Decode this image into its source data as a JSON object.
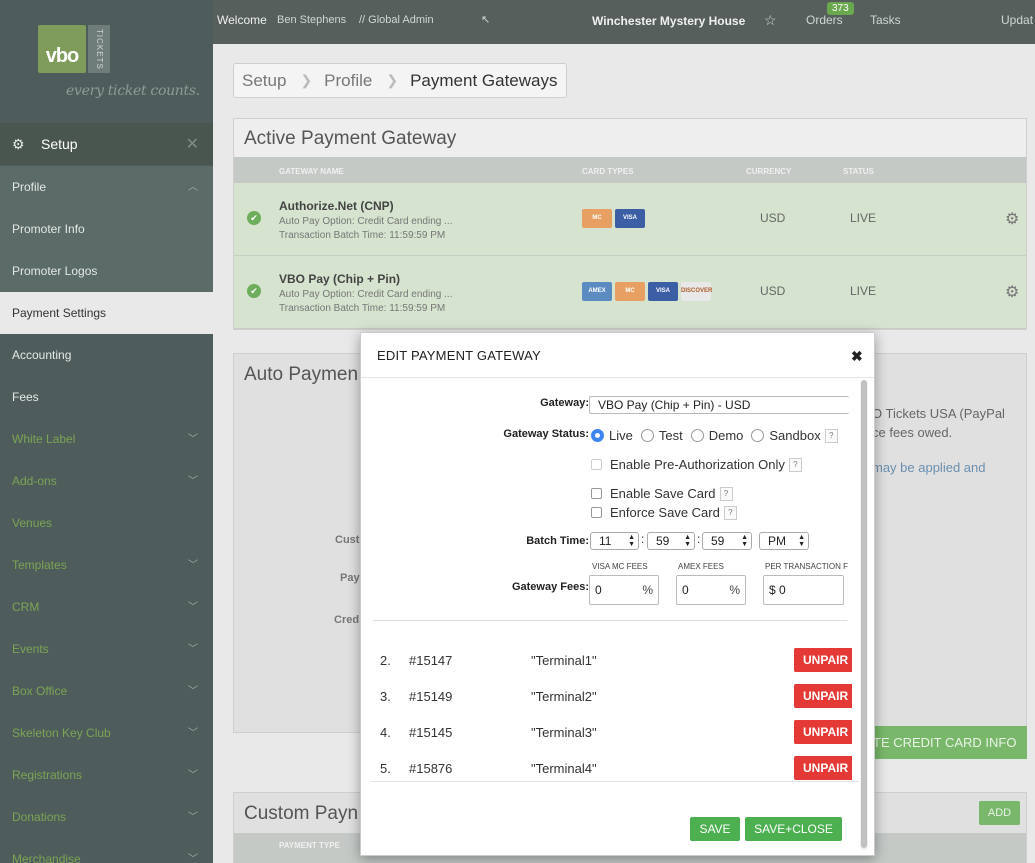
{
  "app": {
    "logo_text": "vbo",
    "logo_side": "TICKETS",
    "tagline": "every ticket counts."
  },
  "sidebar": {
    "header": "Setup",
    "items": [
      {
        "label": "Profile",
        "style": "section",
        "chevron": "up"
      },
      {
        "label": "Promoter Info",
        "style": "section"
      },
      {
        "label": "Promoter Logos",
        "style": "section"
      },
      {
        "label": "Payment Settings",
        "style": "active"
      },
      {
        "label": "Accounting",
        "style": "plain"
      },
      {
        "label": "Fees",
        "style": "plain"
      },
      {
        "label": "White Label",
        "style": "green",
        "chevron": "down"
      },
      {
        "label": "Add-ons",
        "style": "green",
        "chevron": "down"
      },
      {
        "label": "Venues",
        "style": "green"
      },
      {
        "label": "Templates",
        "style": "green",
        "chevron": "down"
      },
      {
        "label": "CRM",
        "style": "green",
        "chevron": "down"
      },
      {
        "label": "Events",
        "style": "green",
        "chevron": "down"
      },
      {
        "label": "Box Office",
        "style": "green",
        "chevron": "down"
      },
      {
        "label": "Skeleton Key Club",
        "style": "green",
        "chevron": "down"
      },
      {
        "label": "Registrations",
        "style": "green",
        "chevron": "down"
      },
      {
        "label": "Donations",
        "style": "green",
        "chevron": "down"
      },
      {
        "label": "Merchandise",
        "style": "green",
        "chevron": "down"
      }
    ]
  },
  "topbar": {
    "welcome": "Welcome",
    "user": "Ben Stephens",
    "role": "// Global Admin",
    "venue": "Winchester Mystery House",
    "orders": "Orders",
    "orders_count": "373",
    "tasks": "Tasks",
    "updates": "Updat"
  },
  "breadcrumb": [
    "Setup",
    "Profile",
    "Payment Gateways"
  ],
  "active_gateway": {
    "title": "Active Payment Gateway",
    "columns": [
      "GATEWAY NAME",
      "CARD TYPES",
      "CURRENCY",
      "STATUS"
    ],
    "rows": [
      {
        "name": "Authorize.Net (CNP)",
        "autopay": "Auto Pay Option: Credit Card ending ...",
        "batch": "Transaction Batch Time: 11:59:59 PM",
        "cards": [
          "mc",
          "visa"
        ],
        "currency": "USD",
        "status": "LIVE"
      },
      {
        "name": "VBO Pay (Chip + Pin)",
        "autopay": "Auto Pay Option: Credit Card ending ...",
        "batch": "Transaction Batch Time: 11:59:59 PM",
        "cards": [
          "amex",
          "mc",
          "visa",
          "disc"
        ],
        "currency": "USD",
        "status": "LIVE"
      }
    ]
  },
  "card_labels": {
    "mc": "MC",
    "visa": "VISA",
    "amex": "AMEX",
    "disc": "DISCOVER"
  },
  "auto_payment": {
    "title": "Auto Paymen",
    "text1": "O Tickets USA (PayPal",
    "text2": "ce fees owed.",
    "text3": "may be applied and",
    "labels": [
      "Cust",
      "Pay",
      "Cred"
    ],
    "update_button": "TE CREDIT CARD INFO"
  },
  "custom_payment": {
    "title": "Custom Payn",
    "add_button": "ADD",
    "column": "PAYMENT TYPE"
  },
  "modal": {
    "title": "EDIT PAYMENT GATEWAY",
    "gateway_label": "Gateway:",
    "gateway_value": "VBO Pay (Chip + Pin) - USD",
    "status_label": "Gateway Status:",
    "status_options": [
      "Live",
      "Test",
      "Demo",
      "Sandbox"
    ],
    "status_selected": "Live",
    "help": "?",
    "preauth_label": "Enable Pre-Authorization Only",
    "save_card_label": "Enable Save Card",
    "enforce_save_label": "Enforce Save Card",
    "batch_label": "Batch Time:",
    "batch_hour": "11",
    "batch_minute": "59",
    "batch_second": "59",
    "batch_ampm": "PM",
    "fees_label": "Gateway Fees:",
    "fee_headers": [
      "VISA MC FEES",
      "AMEX FEES",
      "PER TRANSACTION F"
    ],
    "visa_mc_fee": "0",
    "amex_fee": "0",
    "per_txn_fee": "0",
    "percent": "%",
    "dollar": "$",
    "terminals": [
      {
        "num": "2.",
        "id": "#15147",
        "name": "\"Terminal1\""
      },
      {
        "num": "3.",
        "id": "#15149",
        "name": "\"Terminal2\""
      },
      {
        "num": "4.",
        "id": "#15145",
        "name": "\"Terminal3\""
      },
      {
        "num": "5.",
        "id": "#15876",
        "name": "\"Terminal4\""
      }
    ],
    "unpair_label": "UNPAIR",
    "save_label": "SAVE",
    "save_close_label": "SAVE+CLOSE"
  },
  "colors": {
    "accent_green": "#4caf50",
    "danger_red": "#e53935",
    "radio_blue": "#3d86f0"
  }
}
